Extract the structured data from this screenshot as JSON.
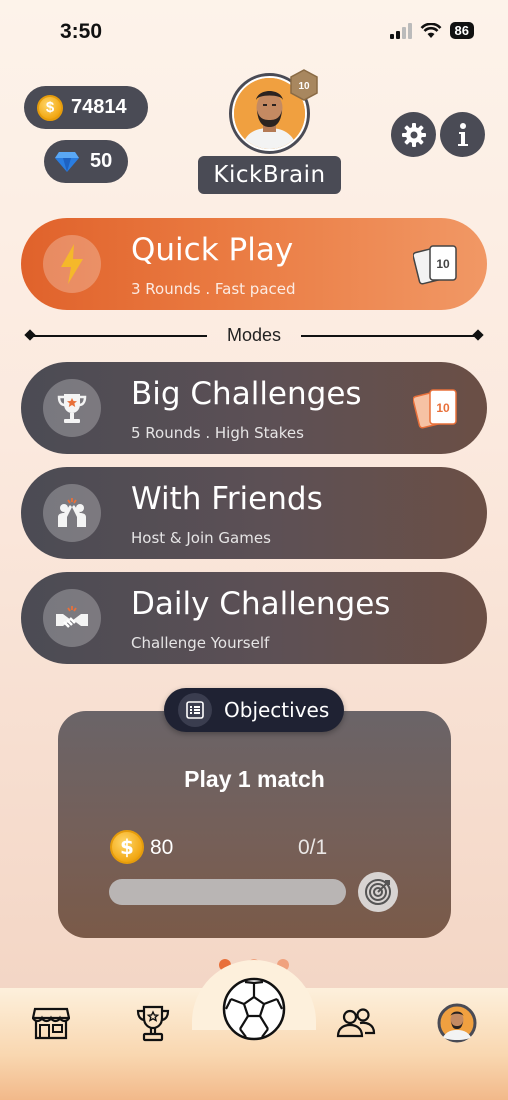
{
  "status_bar": {
    "time": "3:50",
    "battery": "86"
  },
  "currency": {
    "coins": "74814",
    "gems": "50",
    "coin_symbol": "$"
  },
  "profile": {
    "username": "KickBrain",
    "level": "10"
  },
  "quick_play": {
    "title": "Quick Play",
    "subtitle": "3 Rounds . Fast paced",
    "card_value": "10"
  },
  "modes": {
    "label": "Modes",
    "items": [
      {
        "title": "Big Challenges",
        "subtitle": "5 Rounds . High Stakes",
        "icon": "trophy-icon",
        "card_value": "10"
      },
      {
        "title": "With Friends",
        "subtitle": "Host & Join Games",
        "icon": "high-five-icon"
      },
      {
        "title": "Daily Challenges",
        "subtitle": "Challenge Yourself",
        "icon": "handshake-icon"
      }
    ]
  },
  "objectives": {
    "tab_label": "Objectives",
    "task": "Play 1 match",
    "reward": "80",
    "progress_text": "0/1",
    "progress": 0
  },
  "bottom_nav": {
    "items": [
      "shop-icon",
      "trophy-icon",
      "soccer-ball-icon",
      "friends-icon",
      "profile-avatar-icon"
    ]
  },
  "colors": {
    "accent": "#e8703a",
    "dark_pill": "#4a4b55",
    "objective_tab": "#1f2233"
  }
}
